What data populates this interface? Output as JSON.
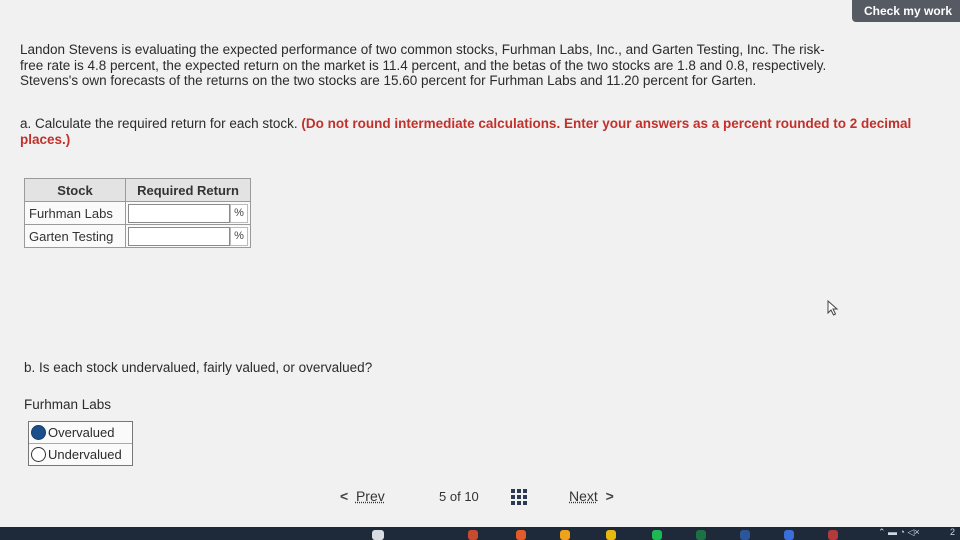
{
  "header": {
    "check_button": "Check my work"
  },
  "problem": {
    "line1": "Landon Stevens is evaluating the expected performance of two common stocks, Furhman Labs, Inc., and Garten Testing, Inc. The risk-",
    "line2": "free rate is 4.8 percent, the expected return on the market is 11.4 percent, and the betas of the two stocks are 1.8 and 0.8, respectively.",
    "line3": "Stevens's own forecasts of the returns on the two stocks are 15.60 percent for Furhman Labs and 11.20 percent for Garten."
  },
  "part_a": {
    "label": "a. Calculate the required return for each stock.",
    "note": "(Do not round intermediate calculations. Enter your answers as a percent rounded to 2 decimal places.)"
  },
  "table": {
    "headers": [
      "Stock",
      "Required Return"
    ],
    "rows": [
      {
        "name": "Furhman Labs",
        "value": "",
        "unit": "%"
      },
      {
        "name": "Garten Testing",
        "value": "",
        "unit": "%"
      }
    ]
  },
  "part_b": {
    "question": "b. Is each stock undervalued, fairly valued, or overvalued?",
    "subject": "Furhman Labs",
    "options": [
      "Overvalued",
      "Undervalued"
    ],
    "selected": "Overvalued"
  },
  "pager": {
    "prev": "Prev",
    "current": "5",
    "of": "of",
    "total": "10",
    "next": "Next"
  },
  "colors": {
    "accent_red": "#c0312b",
    "radio_selected": "#1b4f8a",
    "check_button_bg": "#555a63"
  },
  "taskbar": {
    "clock_partial": "2"
  }
}
